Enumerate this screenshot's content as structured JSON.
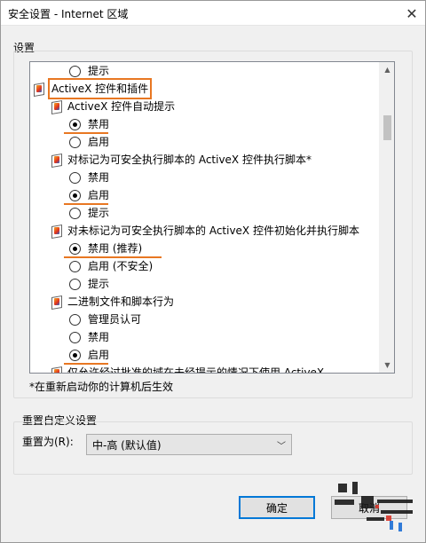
{
  "window": {
    "title": "安全设置 - Internet 区域",
    "close_glyph": "✕"
  },
  "settings_group": {
    "label": "设置",
    "items": [
      {
        "kind": "radio",
        "label": "提示",
        "checked": false
      },
      {
        "kind": "category",
        "label": "ActiveX 控件和插件",
        "highlight": "box"
      },
      {
        "kind": "category",
        "label": "ActiveX 控件自动提示"
      },
      {
        "kind": "radio",
        "label": "禁用",
        "checked": true,
        "underline": true
      },
      {
        "kind": "radio",
        "label": "启用",
        "checked": false
      },
      {
        "kind": "category",
        "label": "对标记为可安全执行脚本的 ActiveX 控件执行脚本*"
      },
      {
        "kind": "radio",
        "label": "禁用",
        "checked": false
      },
      {
        "kind": "radio",
        "label": "启用",
        "checked": true,
        "underline": true
      },
      {
        "kind": "radio",
        "label": "提示",
        "checked": false
      },
      {
        "kind": "category",
        "label": "对未标记为可安全执行脚本的 ActiveX 控件初始化并执行脚本"
      },
      {
        "kind": "radio",
        "label": "禁用 (推荐)",
        "checked": true,
        "underline": true
      },
      {
        "kind": "radio",
        "label": "启用 (不安全)",
        "checked": false
      },
      {
        "kind": "radio",
        "label": "提示",
        "checked": false
      },
      {
        "kind": "category",
        "label": "二进制文件和脚本行为"
      },
      {
        "kind": "radio",
        "label": "管理员认可",
        "checked": false
      },
      {
        "kind": "radio",
        "label": "禁用",
        "checked": false
      },
      {
        "kind": "radio",
        "label": "启用",
        "checked": true,
        "underline": true
      },
      {
        "kind": "category",
        "label": "仅允许经过批准的域在未经提示的情况下使用 ActiveX"
      }
    ],
    "note": "*在重新启动你的计算机后生效"
  },
  "reset_group": {
    "label": "重置自定义设置",
    "reset_to_label": "重置为(R):",
    "selected_value": "中-高 (默认值)"
  },
  "buttons": {
    "ok": "确定",
    "cancel": "取消"
  },
  "colors": {
    "highlight": "#e87722",
    "accent": "#0078d7"
  }
}
